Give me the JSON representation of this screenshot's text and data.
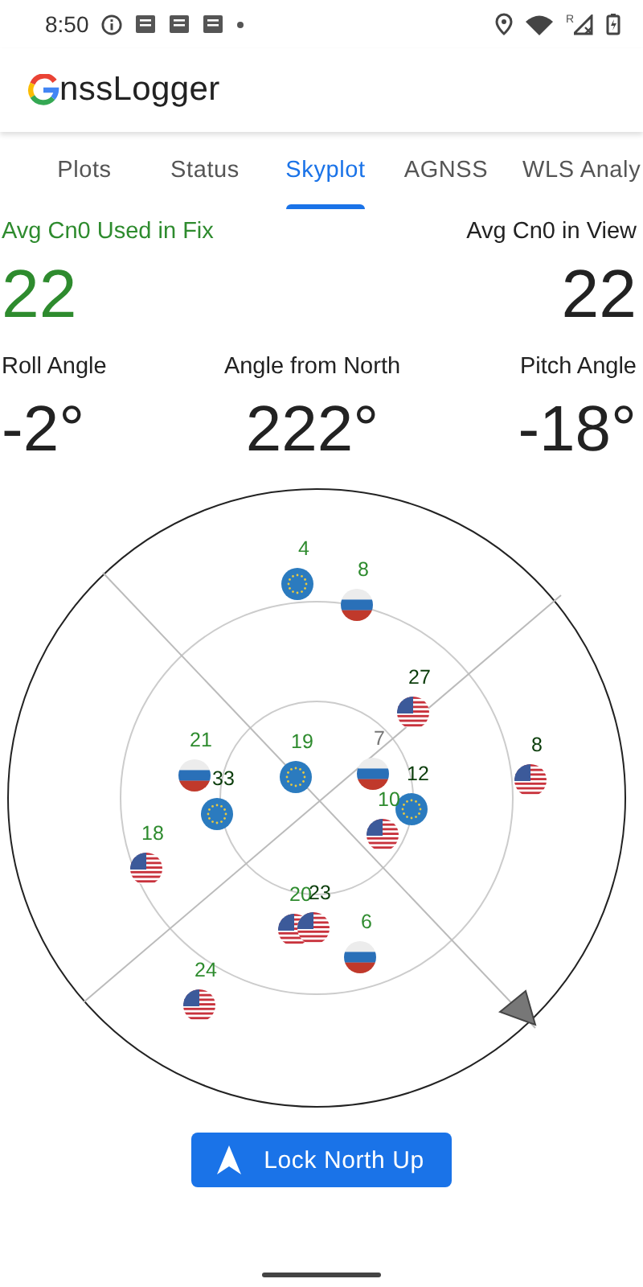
{
  "status_bar": {
    "time": "8:50",
    "signal_badge": "R"
  },
  "app_bar": {
    "title": "nssLogger"
  },
  "tabs": [
    {
      "label": "Plots",
      "selected": false
    },
    {
      "label": "Status",
      "selected": false
    },
    {
      "label": "Skyplot",
      "selected": true
    },
    {
      "label": "AGNSS",
      "selected": false
    },
    {
      "label": "WLS Analy",
      "selected": false
    }
  ],
  "stats": [
    {
      "label": "Avg Cn0 Used in Fix",
      "value": "22",
      "kind": "fix"
    },
    {
      "label": "Avg Cn0 in View",
      "value": "22",
      "kind": "view"
    }
  ],
  "angles": [
    {
      "label": "Roll Angle",
      "value": "-2°"
    },
    {
      "label": "Angle from North",
      "value": "222°"
    },
    {
      "label": "Pitch Angle",
      "value": "-18°"
    }
  ],
  "satellites": [
    {
      "label": "4",
      "kind": "galileo",
      "color": "#2e8b2e"
    },
    {
      "label": "8",
      "kind": "glonass",
      "color": "#2e8b2e"
    },
    {
      "label": "27",
      "kind": "gps",
      "color": "#0b3d0b"
    },
    {
      "label": "21",
      "kind": "glonass",
      "color": "#2e8b2e"
    },
    {
      "label": "33",
      "kind": "galileo",
      "color": "#0b3d0b"
    },
    {
      "label": "19",
      "kind": "galileo",
      "color": "#2e8b2e"
    },
    {
      "label": "7",
      "kind": "glonass",
      "color": "#777777"
    },
    {
      "label": "12",
      "kind": "galileo",
      "color": "#0b3d0b"
    },
    {
      "label": "10",
      "kind": "gps",
      "color": "#2e8b2e"
    },
    {
      "label": "8",
      "kind": "gps",
      "color": "#0b3d0b"
    },
    {
      "label": "18",
      "kind": "gps",
      "color": "#2e8b2e"
    },
    {
      "label": "20",
      "kind": "gps",
      "color": "#2e8b2e"
    },
    {
      "label": "23",
      "kind": "gps",
      "color": "#0b3d0b"
    },
    {
      "label": "6",
      "kind": "glonass",
      "color": "#2e8b2e"
    },
    {
      "label": "24",
      "kind": "gps",
      "color": "#2e8b2e"
    }
  ],
  "button": {
    "label": "Lock North Up"
  }
}
